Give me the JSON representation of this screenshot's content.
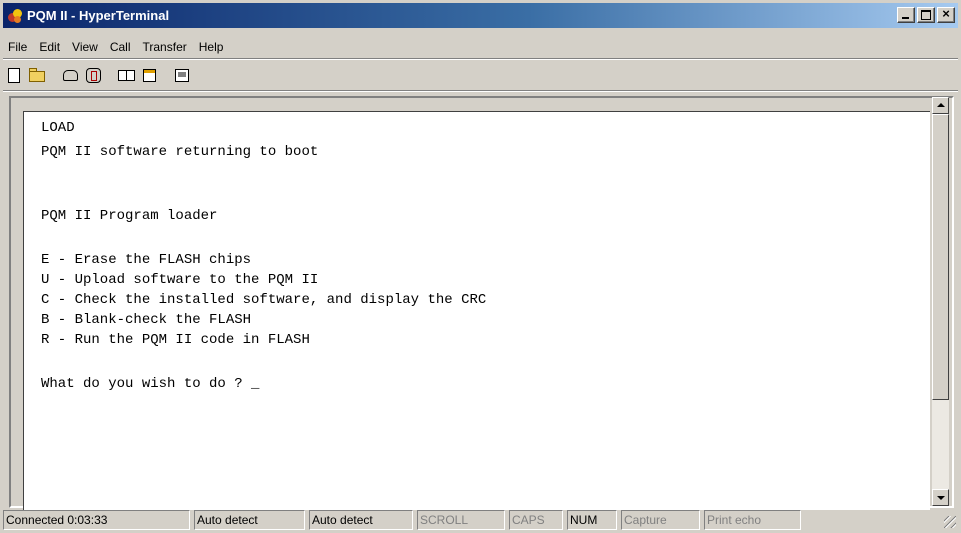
{
  "window": {
    "title": "PQM II - HyperTerminal"
  },
  "menu": [
    "File",
    "Edit",
    "View",
    "Call",
    "Transfer",
    "Help"
  ],
  "toolbar": {
    "buttons": [
      {
        "icon": "new-document-icon"
      },
      {
        "icon": "open-folder-icon"
      },
      {
        "icon": "call-icon"
      },
      {
        "icon": "disconnect-icon"
      },
      {
        "icon": "send-file-icon"
      },
      {
        "icon": "receive-file-icon"
      },
      {
        "icon": "properties-icon"
      }
    ]
  },
  "terminal": {
    "lines": [
      "LOAD",
      "PQM II software returning to boot",
      "",
      "",
      "PQM II Program loader",
      "",
      "E - Erase the FLASH chips",
      "U - Upload software to the PQM II",
      "C - Check the installed software, and display the CRC",
      "B - Blank-check the FLASH",
      "R - Run the PQM II code in FLASH",
      "",
      "What do you wish to do ? _"
    ]
  },
  "status": {
    "connected": "Connected 0:03:33",
    "emulation": "Auto detect",
    "settings": "Auto detect",
    "scroll": "SCROLL",
    "caps": "CAPS",
    "num": "NUM",
    "capture": "Capture",
    "print_echo": "Print echo"
  }
}
